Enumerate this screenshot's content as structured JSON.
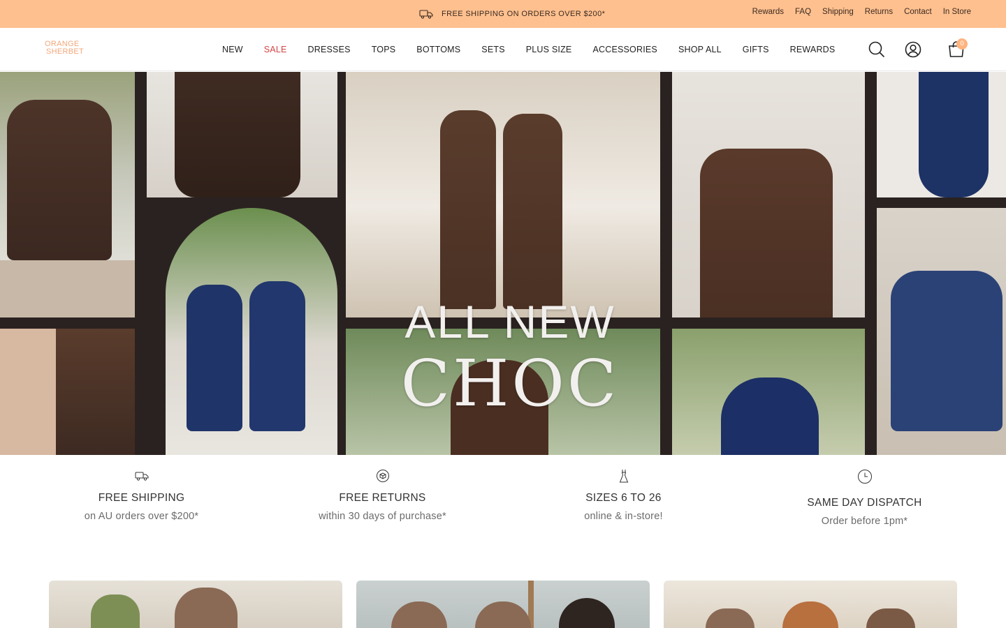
{
  "announcement": {
    "text": "FREE SHIPPING ON ORDERS OVER $200*",
    "icon": "truck-icon"
  },
  "utility_links": [
    "Rewards",
    "FAQ",
    "Shipping",
    "Returns",
    "Contact",
    "In Store"
  ],
  "logo": {
    "line1": "ORANGE",
    "line2": "SHERBET"
  },
  "nav": [
    {
      "label": "NEW"
    },
    {
      "label": "SALE"
    },
    {
      "label": "DRESSES"
    },
    {
      "label": "TOPS"
    },
    {
      "label": "BOTTOMS"
    },
    {
      "label": "SETS"
    },
    {
      "label": "PLUS SIZE"
    },
    {
      "label": "ACCESSORIES"
    },
    {
      "label": "SHOP ALL"
    },
    {
      "label": "GIFTS"
    },
    {
      "label": "REWARDS"
    }
  ],
  "header_icons": {
    "search": "search-icon",
    "account": "user-icon",
    "cart": "bag-icon",
    "cart_count": "0"
  },
  "hero": {
    "line1": "ALL NEW",
    "line2": "CHOC"
  },
  "features": [
    {
      "icon": "truck-icon",
      "title": "FREE SHIPPING",
      "subtitle": "on AU orders over $200*"
    },
    {
      "icon": "returns-icon",
      "title": "FREE RETURNS",
      "subtitle": "within 30 days of purchase*"
    },
    {
      "icon": "dress-icon",
      "title": "SIZES 6 TO 26",
      "subtitle": "online & in-store!"
    },
    {
      "icon": "clock-icon",
      "title": "SAME DAY DISPATCH",
      "subtitle": "Order before 1pm*"
    }
  ],
  "colors": {
    "announcement_bg": "#ffc08f",
    "sale": "#d14545",
    "brand": "#f3a77a"
  }
}
